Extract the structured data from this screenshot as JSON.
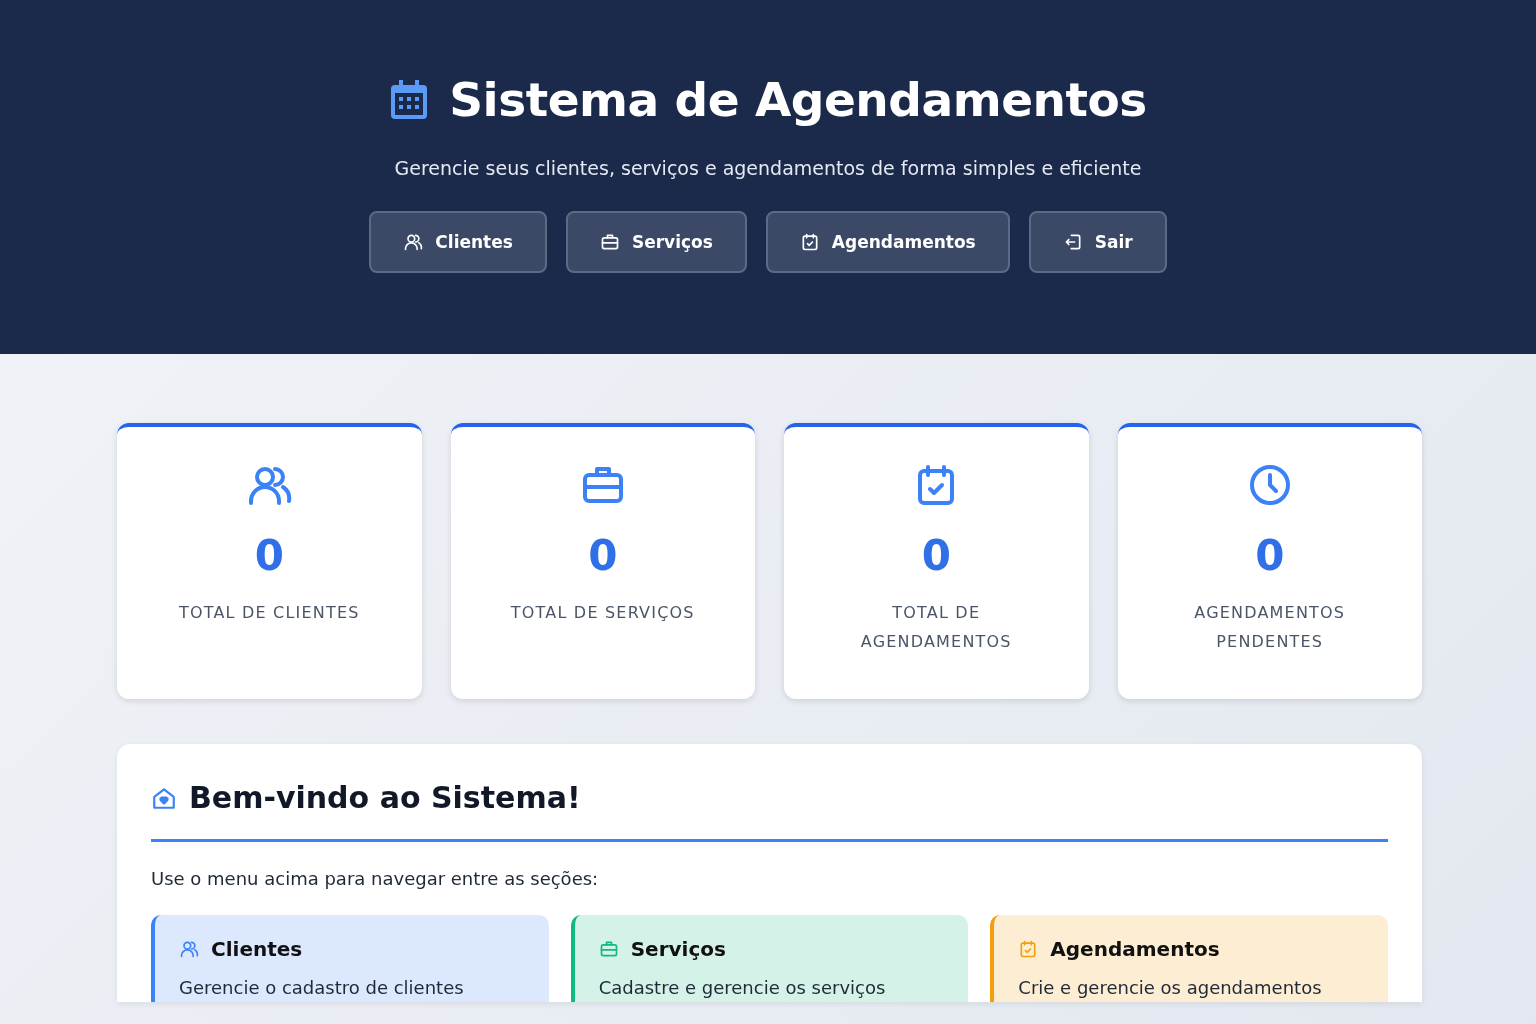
{
  "header": {
    "title": "Sistema de Agendamentos",
    "subtitle": "Gerencie seus clientes, serviços e agendamentos de forma simples e eficiente",
    "nav": [
      {
        "label": "Clientes",
        "kind": "users"
      },
      {
        "label": "Serviços",
        "kind": "briefcase"
      },
      {
        "label": "Agendamentos",
        "kind": "calendar-check"
      },
      {
        "label": "Sair",
        "kind": "logout"
      }
    ]
  },
  "stats": [
    {
      "value": "0",
      "label": "TOTAL DE CLIENTES",
      "kind": "users"
    },
    {
      "value": "0",
      "label": "TOTAL DE SERVIÇOS",
      "kind": "briefcase"
    },
    {
      "value": "0",
      "label": "TOTAL DE AGENDAMENTOS",
      "kind": "calendar-check"
    },
    {
      "value": "0",
      "label": "AGENDAMENTOS PENDENTES",
      "kind": "clock"
    }
  ],
  "welcome": {
    "title": "Bem-vindo ao Sistema!",
    "intro": "Use o menu acima para navegar entre as seções:",
    "sections": [
      {
        "title": "Clientes",
        "text": "Gerencie o cadastro de clientes",
        "kind": "users",
        "color": "#3b82f6"
      },
      {
        "title": "Serviços",
        "text": "Cadastre e gerencie os serviços",
        "kind": "briefcase",
        "color": "#10b981"
      },
      {
        "title": "Agendamentos",
        "text": "Crie e gerencie os agendamentos",
        "kind": "calendar-check",
        "color": "#f59e0b"
      }
    ]
  }
}
